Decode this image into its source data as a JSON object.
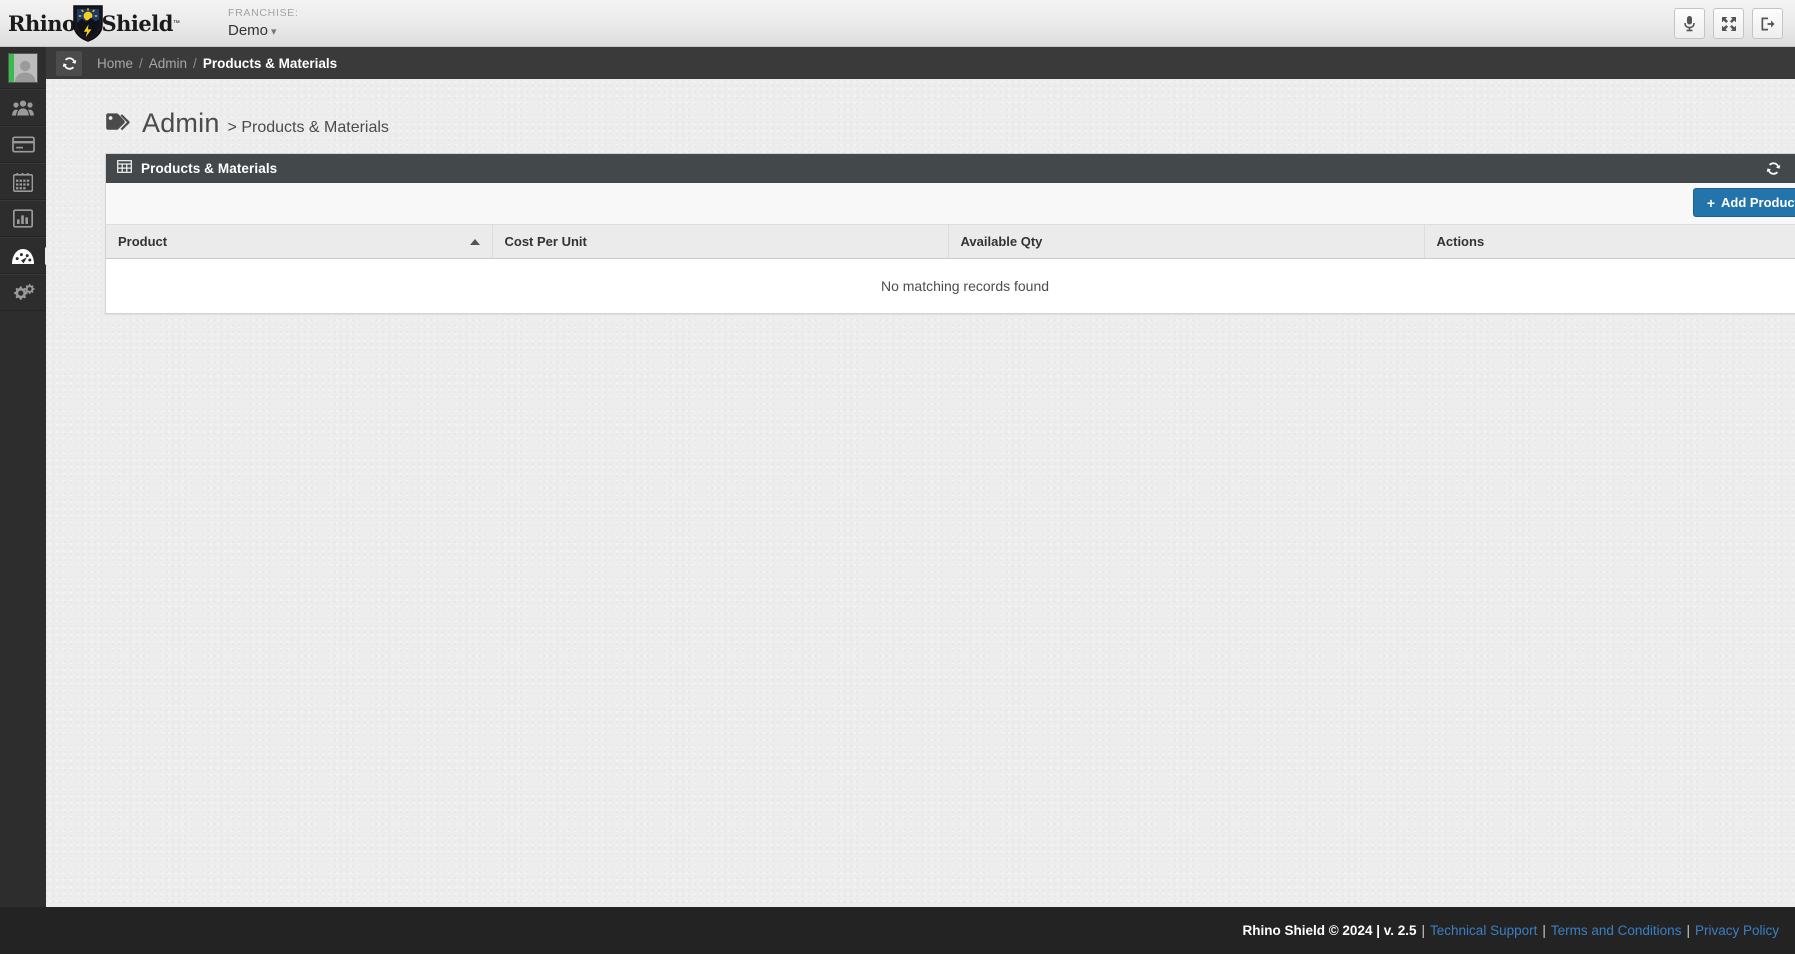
{
  "colors": {
    "accent_blue": "#2374ab",
    "link_blue": "#3b7fc4",
    "panel_header": "#43484b",
    "crumbbar": "#3a3a3a",
    "sidebar": "#2d2d2d",
    "footer": "#232323",
    "body_bg": "#ededed",
    "avatar_accent_green": "#36bd4a"
  },
  "topbar": {
    "logo": {
      "word_left": "Rhino",
      "word_right": "Shield",
      "trademark": "™",
      "icon": "shield-logo-icon"
    },
    "franchise": {
      "label": "FRANCHISE:",
      "value": "Demo",
      "caret": "⌄"
    },
    "actions": [
      {
        "name": "microphone-button",
        "icon": "microphone-icon",
        "title": "Voice"
      },
      {
        "name": "fullscreen-button",
        "icon": "fullscreen-arrows-icon",
        "title": "Fullscreen"
      },
      {
        "name": "logout-button",
        "icon": "logout-icon",
        "title": "Log out"
      }
    ]
  },
  "sidebar": {
    "items": [
      {
        "name": "sidebar-item-profile",
        "icon": "user-avatar-icon",
        "label": "Profile",
        "active": false
      },
      {
        "name": "sidebar-item-customers",
        "icon": "users-group-icon",
        "label": "Customers",
        "active": false
      },
      {
        "name": "sidebar-item-payments",
        "icon": "credit-card-icon",
        "label": "Payments",
        "active": false
      },
      {
        "name": "sidebar-item-calendar",
        "icon": "calendar-icon",
        "label": "Calendar",
        "active": false
      },
      {
        "name": "sidebar-item-reports",
        "icon": "bar-chart-icon",
        "label": "Reports",
        "active": false
      },
      {
        "name": "sidebar-item-dashboard",
        "icon": "gauge-dashboard-icon",
        "label": "Dashboard",
        "active": true
      },
      {
        "name": "sidebar-item-admin",
        "icon": "gears-settings-icon",
        "label": "Admin",
        "active": false
      }
    ]
  },
  "breadcrumb": {
    "refresh_icon": "refresh-icon",
    "items": [
      {
        "label": "Home",
        "current": false
      },
      {
        "label": "Admin",
        "current": false
      },
      {
        "label": "Products & Materials",
        "current": true
      }
    ],
    "separator": "/"
  },
  "page": {
    "icon": "tags-icon",
    "title": "Admin",
    "subtitle": "> Products & Materials"
  },
  "panel": {
    "icon": "table-grid-icon",
    "title": "Products & Materials",
    "header_actions": [
      {
        "name": "panel-refresh-button",
        "icon": "refresh-icon"
      },
      {
        "name": "panel-expand-button",
        "icon": "expand-diagonal-icon"
      }
    ],
    "toolbar": {
      "add_product_label": "Add Product",
      "add_product_plus": "+"
    },
    "table": {
      "columns": [
        {
          "label": "Product",
          "sort": "asc"
        },
        {
          "label": "Cost Per Unit",
          "sort": null
        },
        {
          "label": "Available Qty",
          "sort": null
        },
        {
          "label": "Actions",
          "sort": null
        }
      ],
      "rows": [],
      "empty_message": "No matching records found"
    }
  },
  "footer": {
    "copyright": "Rhino Shield © 2024 | v. 2.5",
    "separator": "|",
    "links": [
      {
        "label": "Technical Support"
      },
      {
        "label": "Terms and Conditions"
      },
      {
        "label": "Privacy Policy"
      }
    ]
  }
}
